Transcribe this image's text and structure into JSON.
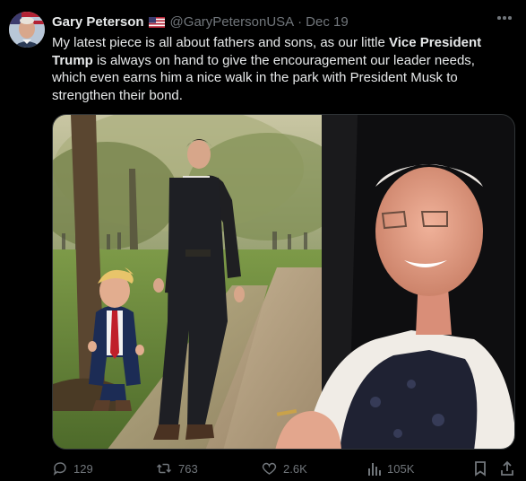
{
  "tweet": {
    "author": {
      "name": "Gary Peterson",
      "handle": "@GaryPetersonUSA",
      "separator": "·",
      "date": "Dec 19",
      "flag_icon": "us-flag-emoji"
    },
    "text": {
      "part1": "My latest piece is all about fathers and sons, as our little ",
      "bold": "Vice President Trump",
      "part2": " is always on hand to give the encouragement our leader needs, which even earns him a nice walk in the park with President Musk to strengthen their bond."
    },
    "metrics": {
      "replies": "129",
      "reposts": "763",
      "likes": "2.6K",
      "views": "105K"
    },
    "icons": {
      "more": "more-dots-icon",
      "reply": "reply-icon",
      "repost": "repost-icon",
      "like": "heart-icon",
      "views": "views-chart-icon",
      "bookmark": "bookmark-icon",
      "share": "share-icon"
    },
    "colors": {
      "background": "#000000",
      "text": "#e7e9ea",
      "muted": "#71767b",
      "border": "#2f3336"
    }
  }
}
